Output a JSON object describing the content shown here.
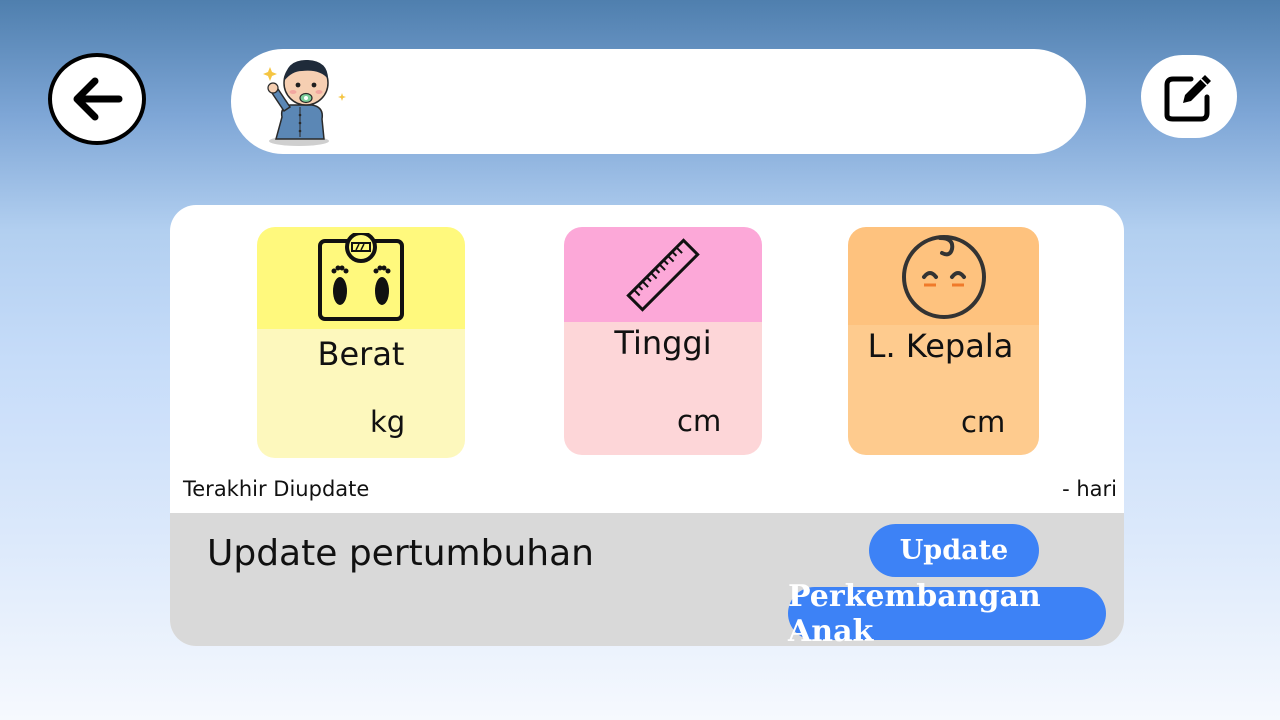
{
  "header": {
    "back_icon": "arrow-left-icon",
    "avatar_icon": "baby-avatar",
    "edit_icon": "edit-icon",
    "child_name": ""
  },
  "measurements": [
    {
      "label": "Berat",
      "unit": "kg",
      "value": "",
      "icon": "scale-icon",
      "top_color": "#fff97d",
      "bottom_color": "#fdf8bd"
    },
    {
      "label": "Tinggi",
      "unit": "cm",
      "value": "",
      "icon": "ruler-icon",
      "top_color": "#fca8d8",
      "bottom_color": "#fdd6d8"
    },
    {
      "label": "L. Kepala",
      "unit": "cm",
      "value": "",
      "icon": "baby-head-icon",
      "top_color": "#fec27e",
      "bottom_color": "#fecb8e"
    }
  ],
  "status": {
    "last_updated_label": "Terakhir Diupdate",
    "days_text": "- hari"
  },
  "footer": {
    "title": "Update pertumbuhan",
    "update_label": "Update",
    "development_label": "Perkembangan Anak",
    "button_color": "#3d82f6"
  }
}
